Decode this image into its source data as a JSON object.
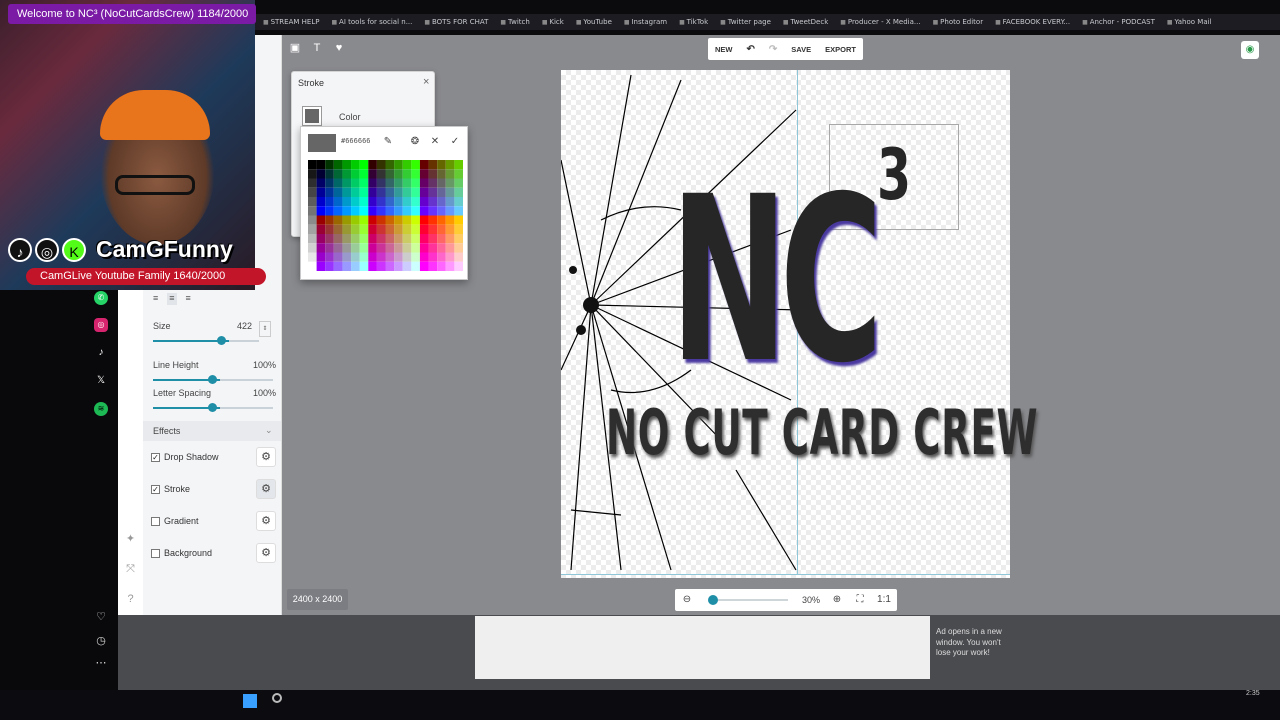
{
  "stream": {
    "title": "Welcome to NC³ (NoCutCardsCrew) 1184/2000",
    "name": "CamGFunny",
    "subtitle": "CamGLive Youtube Family 1640/2000"
  },
  "bookmarks": [
    "STREAM HELP",
    "AI tools for social n...",
    "BOTS FOR CHAT",
    "Twitch",
    "Kick",
    "YouTube",
    "Instagram",
    "TikTok",
    "Twitter page",
    "TweetDeck",
    "Producer - X Media...",
    "Photo Editor",
    "FACEBOOK EVERY...",
    "Anchor - PODCAST",
    "Yahoo Mail"
  ],
  "toolbar": {
    "new": "NEW",
    "save": "SAVE",
    "export": "EXPORT"
  },
  "panel": {
    "size_label": "Size",
    "size_value": "422",
    "line_height_label": "Line Height",
    "line_height_value": "100%",
    "letter_spacing_label": "Letter Spacing",
    "letter_spacing_value": "100%",
    "effects_label": "Effects",
    "effects": [
      {
        "label": "Drop Shadow",
        "checked": true
      },
      {
        "label": "Stroke",
        "checked": true
      },
      {
        "label": "Gradient",
        "checked": false
      },
      {
        "label": "Background",
        "checked": false
      }
    ],
    "size_fraction": 0.72,
    "line_height_fraction": 0.56,
    "letter_spacing_fraction": 0.56
  },
  "stroke_popup": {
    "title": "Stroke",
    "color_label": "Color",
    "color": "#666666"
  },
  "color_picker": {
    "hex": "#666666"
  },
  "canvas": {
    "main_text": "NC",
    "sup_text": "3",
    "sub_text": "NO CUT CARD CREW"
  },
  "status": {
    "dimensions": "2400 x 2400",
    "zoom": "30%",
    "zoom_fraction": 0.05,
    "ratio": "1:1"
  },
  "ad": {
    "text": "Ad opens in a new window. You won't lose your work!"
  },
  "clock": "2:35",
  "colors": {
    "accent": "#1f8fa8",
    "stream_banner": "#7a1aa5",
    "stream_sub": "#c3152a"
  }
}
